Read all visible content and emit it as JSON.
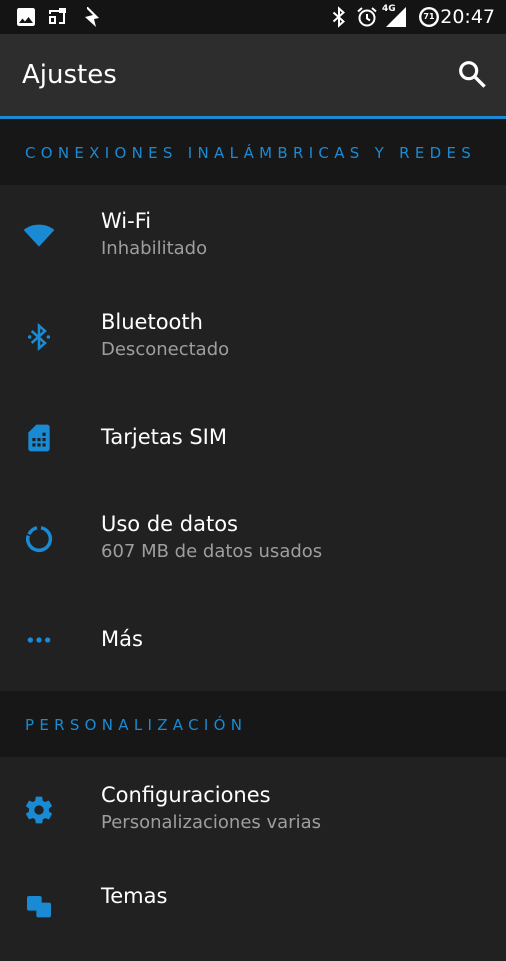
{
  "status_bar": {
    "time": "20:47",
    "network_label": "4G",
    "battery_level": "71",
    "icons": [
      "image-icon",
      "cast-icon",
      "flash-icon",
      "bluetooth-icon",
      "alarm-icon",
      "signal-icon",
      "battery-icon"
    ]
  },
  "app_bar": {
    "title": "Ajustes",
    "search_icon": "search-icon"
  },
  "sections": {
    "wireless": {
      "header": "CONEXIONES INALÁMBRICAS Y REDES",
      "items": [
        {
          "title": "Wi-Fi",
          "subtitle": "Inhabilitado",
          "icon": "wifi-icon"
        },
        {
          "title": "Bluetooth",
          "subtitle": "Desconectado",
          "icon": "bluetooth-icon"
        },
        {
          "title": "Tarjetas SIM",
          "icon": "sim-card-icon"
        },
        {
          "title": "Uso de datos",
          "subtitle": "607 MB de datos usados",
          "icon": "data-usage-icon"
        },
        {
          "title": "Más",
          "icon": "more-horiz-icon"
        }
      ]
    },
    "personalization": {
      "header": "PERSONALIZACIÓN",
      "items": [
        {
          "title": "Configuraciones",
          "subtitle": "Personalizaciones varias",
          "icon": "gear-icon"
        },
        {
          "title": "Temas",
          "icon": "themes-icon"
        }
      ]
    }
  },
  "colors": {
    "accent": "#1a8ad4",
    "background": "#212121",
    "app_bar": "#2d2d2d",
    "status_bar": "#141414",
    "section_header_bg": "#171717",
    "primary_text": "#ffffff",
    "secondary_text": "#9e9e9e"
  }
}
